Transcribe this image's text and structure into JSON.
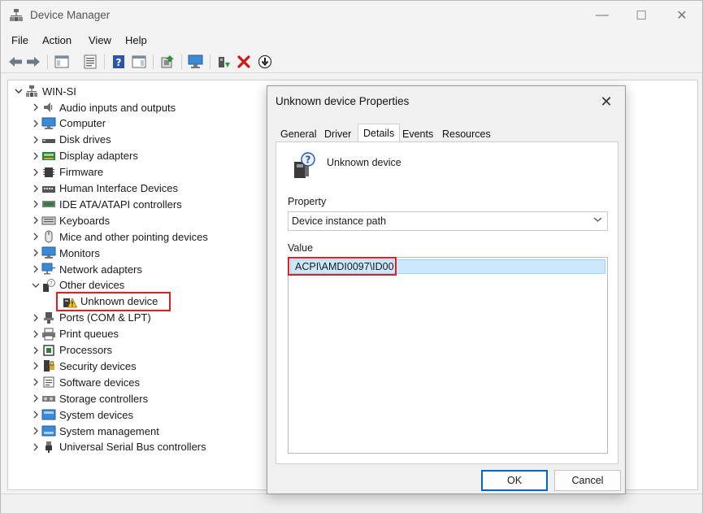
{
  "window": {
    "title": "Device Manager",
    "minimize": "—",
    "maximize": "☐",
    "close": "✕"
  },
  "menu": [
    "File",
    "Action",
    "View",
    "Help"
  ],
  "toolbar": {
    "icons": [
      "back-arrow-icon",
      "forward-arrow-icon",
      "show-hide-console-tree-icon",
      "properties-icon",
      "help-icon",
      "action-pane-icon",
      "update-driver-icon",
      "scan-hardware-icon",
      "add-driver-icon",
      "uninstall-icon",
      "disable-device-icon"
    ]
  },
  "tree": {
    "root": "WIN-SI",
    "categories": [
      {
        "label": "Audio inputs and outputs",
        "icon": "speaker-icon",
        "expanded": false
      },
      {
        "label": "Computer",
        "icon": "computer-icon",
        "expanded": false
      },
      {
        "label": "Disk drives",
        "icon": "disk-drive-icon",
        "expanded": false
      },
      {
        "label": "Display adapters",
        "icon": "display-adapter-icon",
        "expanded": false
      },
      {
        "label": "Firmware",
        "icon": "firmware-icon",
        "expanded": false
      },
      {
        "label": "Human Interface Devices",
        "icon": "hid-icon",
        "expanded": false
      },
      {
        "label": "IDE ATA/ATAPI controllers",
        "icon": "ide-controller-icon",
        "expanded": false
      },
      {
        "label": "Keyboards",
        "icon": "keyboard-icon",
        "expanded": false
      },
      {
        "label": "Mice and other pointing devices",
        "icon": "mouse-icon",
        "expanded": false
      },
      {
        "label": "Monitors",
        "icon": "monitor-icon",
        "expanded": false
      },
      {
        "label": "Network adapters",
        "icon": "network-adapter-icon",
        "expanded": false
      },
      {
        "label": "Other devices",
        "icon": "other-devices-icon",
        "expanded": true
      },
      {
        "label": "Unknown device",
        "icon": "unknown-device-warning-icon",
        "child": true
      },
      {
        "label": "Ports (COM & LPT)",
        "icon": "port-icon",
        "expanded": false
      },
      {
        "label": "Print queues",
        "icon": "printer-icon",
        "expanded": false
      },
      {
        "label": "Processors",
        "icon": "processor-icon",
        "expanded": false
      },
      {
        "label": "Security devices",
        "icon": "security-device-icon",
        "expanded": false
      },
      {
        "label": "Software devices",
        "icon": "software-device-icon",
        "expanded": false
      },
      {
        "label": "Storage controllers",
        "icon": "storage-controller-icon",
        "expanded": false
      },
      {
        "label": "System devices",
        "icon": "system-device-icon",
        "expanded": false
      },
      {
        "label": "System management",
        "icon": "system-management-icon",
        "expanded": false
      },
      {
        "label": "Universal Serial Bus controllers",
        "icon": "usb-icon",
        "expanded": false
      }
    ]
  },
  "dialog": {
    "title": "Unknown device Properties",
    "close": "✕",
    "tabs": [
      "General",
      "Driver",
      "Details",
      "Events",
      "Resources"
    ],
    "active_tab": "Details",
    "device_name": "Unknown device",
    "property_label": "Property",
    "property_value": "Device instance path",
    "value_label": "Value",
    "value_text": "ACPI\\AMDI0097\\ID00",
    "ok_label": "OK",
    "cancel_label": "Cancel"
  },
  "colors": {
    "highlight": "#e02020",
    "selection": "#cce8ff",
    "accent": "#0067c0"
  }
}
